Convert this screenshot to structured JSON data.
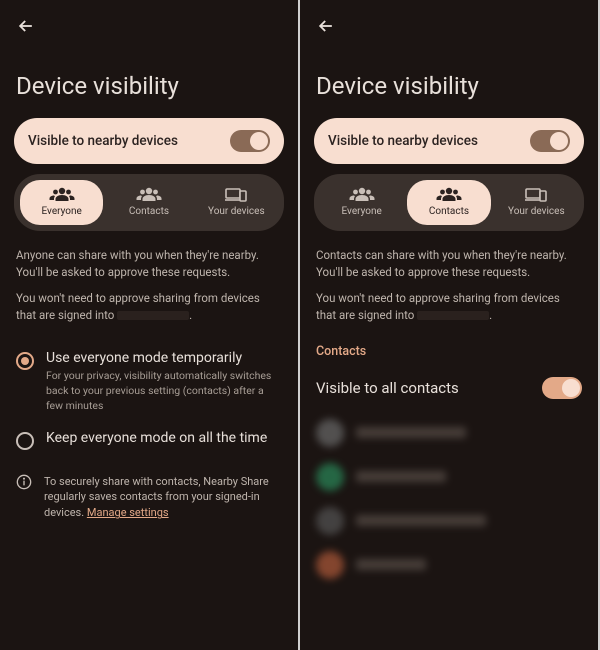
{
  "left": {
    "title": "Device visibility",
    "toggle_label": "Visible to nearby devices",
    "tabs": {
      "everyone": "Everyone",
      "contacts": "Contacts",
      "devices": "Your devices",
      "selected": "everyone"
    },
    "desc1": "Anyone can share with you when they're nearby. You'll be asked to approve these requests.",
    "desc2_prefix": "You won't need to approve sharing from devices that are signed into",
    "desc2_suffix": ".",
    "radio": {
      "temp_title": "Use everyone mode temporarily",
      "temp_sub": "For your privacy, visibility automatically switches back to your previous setting (contacts) after a few minutes",
      "always_title": "Keep everyone mode on all the time",
      "selected": "temp"
    },
    "info": "To securely share with contacts, Nearby Share regularly saves contacts from your signed-in devices.",
    "info_link": "Manage settings"
  },
  "right": {
    "title": "Device visibility",
    "toggle_label": "Visible to nearby devices",
    "tabs": {
      "everyone": "Everyone",
      "contacts": "Contacts",
      "devices": "Your devices",
      "selected": "contacts"
    },
    "desc1": "Contacts can share with you when they're nearby. You'll be asked to approve these requests.",
    "desc2_prefix": "You won't need to approve sharing from devices that are signed into",
    "desc2_suffix": ".",
    "section_label": "Contacts",
    "all_contacts_label": "Visible to all contacts"
  }
}
